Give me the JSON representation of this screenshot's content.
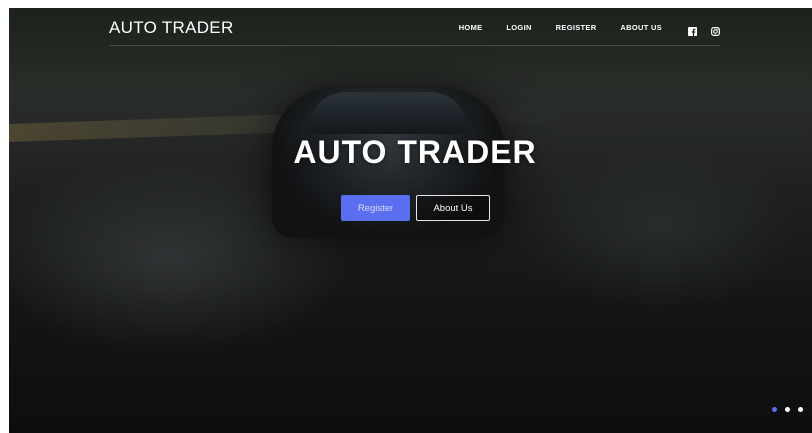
{
  "brand": {
    "name": "AUTO TRADER"
  },
  "nav": {
    "items": [
      {
        "label": "HOME"
      },
      {
        "label": "LOGIN"
      },
      {
        "label": "REGISTER"
      },
      {
        "label": "ABOUT US"
      }
    ],
    "social": [
      {
        "icon": "facebook-icon"
      },
      {
        "icon": "instagram-icon"
      }
    ]
  },
  "hero": {
    "title": "AUTO TRADER",
    "buttons": {
      "register_label": "Register",
      "about_label": "About Us"
    }
  },
  "carousel": {
    "slide_count": 3,
    "active_index": 0
  },
  "colors": {
    "accent": "#5b6ef0",
    "text": "#ffffff"
  }
}
